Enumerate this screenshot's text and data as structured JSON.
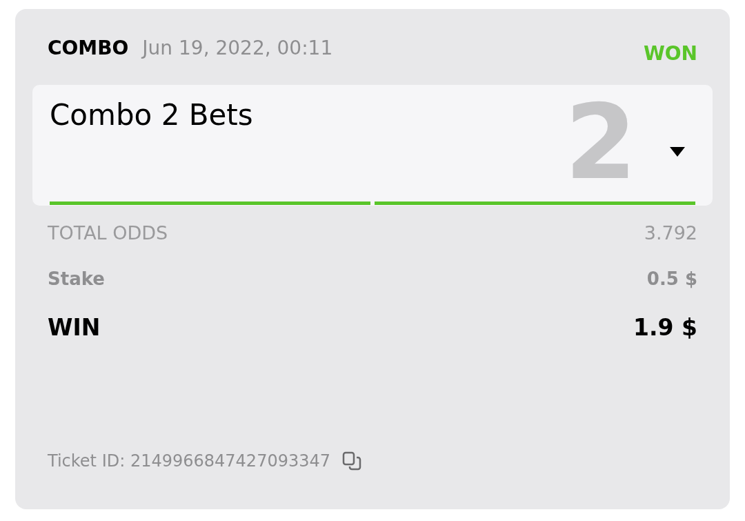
{
  "header": {
    "type": "COMBO",
    "date": "Jun 19, 2022, 00:11",
    "status": "WON"
  },
  "bet": {
    "title": "Combo 2 Bets",
    "count": "2",
    "expanded": false,
    "legs": [
      {
        "won": true
      },
      {
        "won": true
      }
    ]
  },
  "rows": [
    {
      "kind": "odds",
      "label": "TOTAL ODDS",
      "value": "3.792"
    },
    {
      "kind": "stake",
      "label": "Stake",
      "value": "0.5 $"
    },
    {
      "kind": "win",
      "label": "WIN",
      "value": "1.9 $"
    }
  ],
  "ticket": "Ticket ID: 2149966847427093347"
}
